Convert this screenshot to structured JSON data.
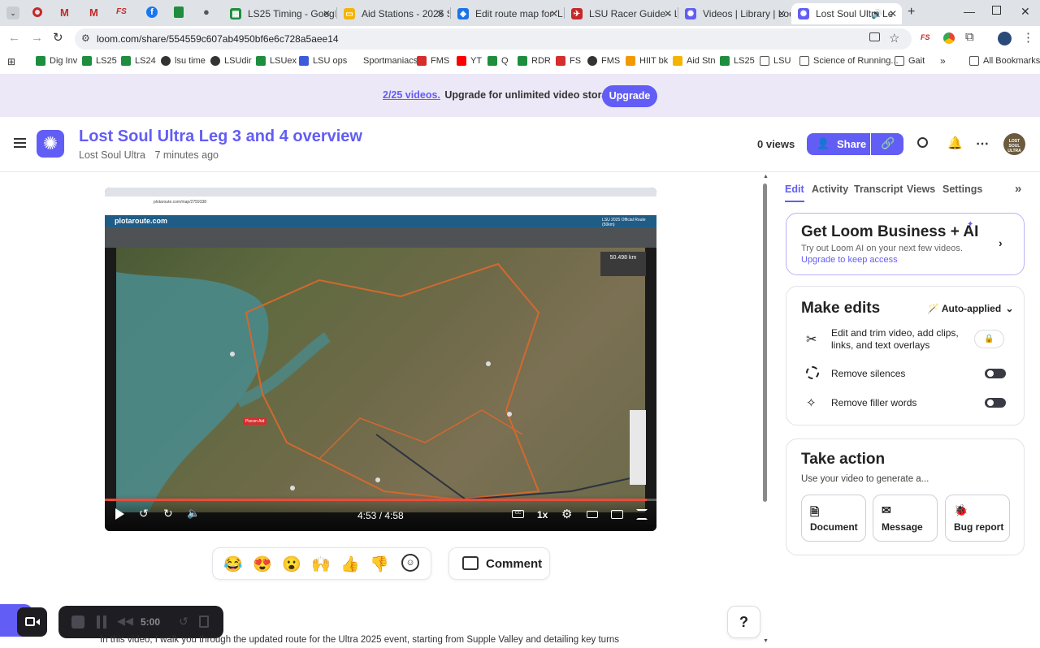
{
  "browser": {
    "tabs": [
      {
        "label": "LS25 Timing - Googl",
        "color": "#1e8e3e",
        "glyph": "▦"
      },
      {
        "label": "Aid Stations - 2025 S",
        "color": "#f4b400",
        "glyph": "▭"
      },
      {
        "label": "Edit route map for 'L",
        "color": "#1a73e8",
        "glyph": "◈"
      },
      {
        "label": "LSU Racer Guide - LS",
        "color": "#c62828",
        "glyph": "✈"
      },
      {
        "label": "Videos | Library | Loo",
        "color": "#625df5",
        "glyph": "✺"
      },
      {
        "label": "Lost Soul Ultra Le",
        "color": "#625df5",
        "glyph": "✺"
      }
    ],
    "url": "loom.com/share/554559c607ab4950bf6e6c728a5aee14",
    "bookmarks": [
      {
        "label": "Dig Inv",
        "color": "#1e8e3e"
      },
      {
        "label": "LS25",
        "color": "#1e8e3e"
      },
      {
        "label": "LS24",
        "color": "#1e8e3e"
      },
      {
        "label": "lsu time",
        "color": "#333"
      },
      {
        "label": "LSUdir",
        "color": "#333"
      },
      {
        "label": "LSUex",
        "color": "#1e8e3e"
      },
      {
        "label": "LSU ops",
        "color": "#3b5bdb"
      },
      {
        "label": "Sportmaniacs",
        "color": "#ffffff"
      },
      {
        "label": "FMS",
        "color": "#d62d2d"
      },
      {
        "label": "YT",
        "color": "#ff0000"
      },
      {
        "label": "Q",
        "color": "#1e8e3e"
      },
      {
        "label": "RDR",
        "color": "#1e8e3e"
      },
      {
        "label": "FS",
        "color": "#d62d2d"
      },
      {
        "label": "FMS",
        "color": "#333"
      },
      {
        "label": "HIIT bk",
        "color": "#f29900"
      },
      {
        "label": "Aid Stn",
        "color": "#f4b400"
      },
      {
        "label": "LS25",
        "color": "#1e8e3e"
      },
      {
        "label": "LSU",
        "color": "#555"
      },
      {
        "label": "Science of Running...",
        "color": "#555"
      },
      {
        "label": "Gait",
        "color": "#555"
      }
    ],
    "all_bookmarks": "All Bookmarks"
  },
  "banner": {
    "count": "2/25 videos.",
    "text": "Upgrade for unlimited video storage.",
    "button": "Upgrade"
  },
  "header": {
    "title": "Lost Soul Ultra Leg 3 and 4 overview",
    "author": "Lost Soul Ultra",
    "time": "7 minutes ago",
    "views": "0 views",
    "share": "Share",
    "avatar_text": "LOST SOUL ULTRA"
  },
  "player": {
    "time": "4:53 / 4:58",
    "speed": "1x",
    "progress": 0.983,
    "inner_url": "plotaroute.com/map/2759338",
    "inner_brand": "plotaroute.com",
    "inner_route_title": "LSU 2025 Official Route (50km)",
    "inner_distance": "50.498 km",
    "inner_pin": "Piscon Aid"
  },
  "reactions": [
    "😂",
    "😍",
    "😮",
    "🙌",
    "👍",
    "👎"
  ],
  "comment_label": "Comment",
  "recorder": {
    "time": "5:00"
  },
  "transcript_preview": "In this video, I walk you through the updated route for the Ultra 2025 event, starting from Supple Valley and detailing key turns",
  "help": "?",
  "panel": {
    "tabs": [
      "Edit",
      "Activity",
      "Transcript",
      "Views",
      "Settings"
    ],
    "promo": {
      "title": "Get Loom Business + AI",
      "line1": "Try out Loom AI on your next few videos.",
      "line2": "Upgrade to keep access"
    },
    "edits": {
      "title": "Make edits",
      "mode": "Auto-applied",
      "items": [
        "Edit and trim video, add clips, links, and text overlays",
        "Remove silences",
        "Remove filler words"
      ]
    },
    "action": {
      "title": "Take action",
      "subtitle": "Use your video to generate a...",
      "buttons": [
        "Document",
        "Message",
        "Bug report"
      ]
    }
  }
}
